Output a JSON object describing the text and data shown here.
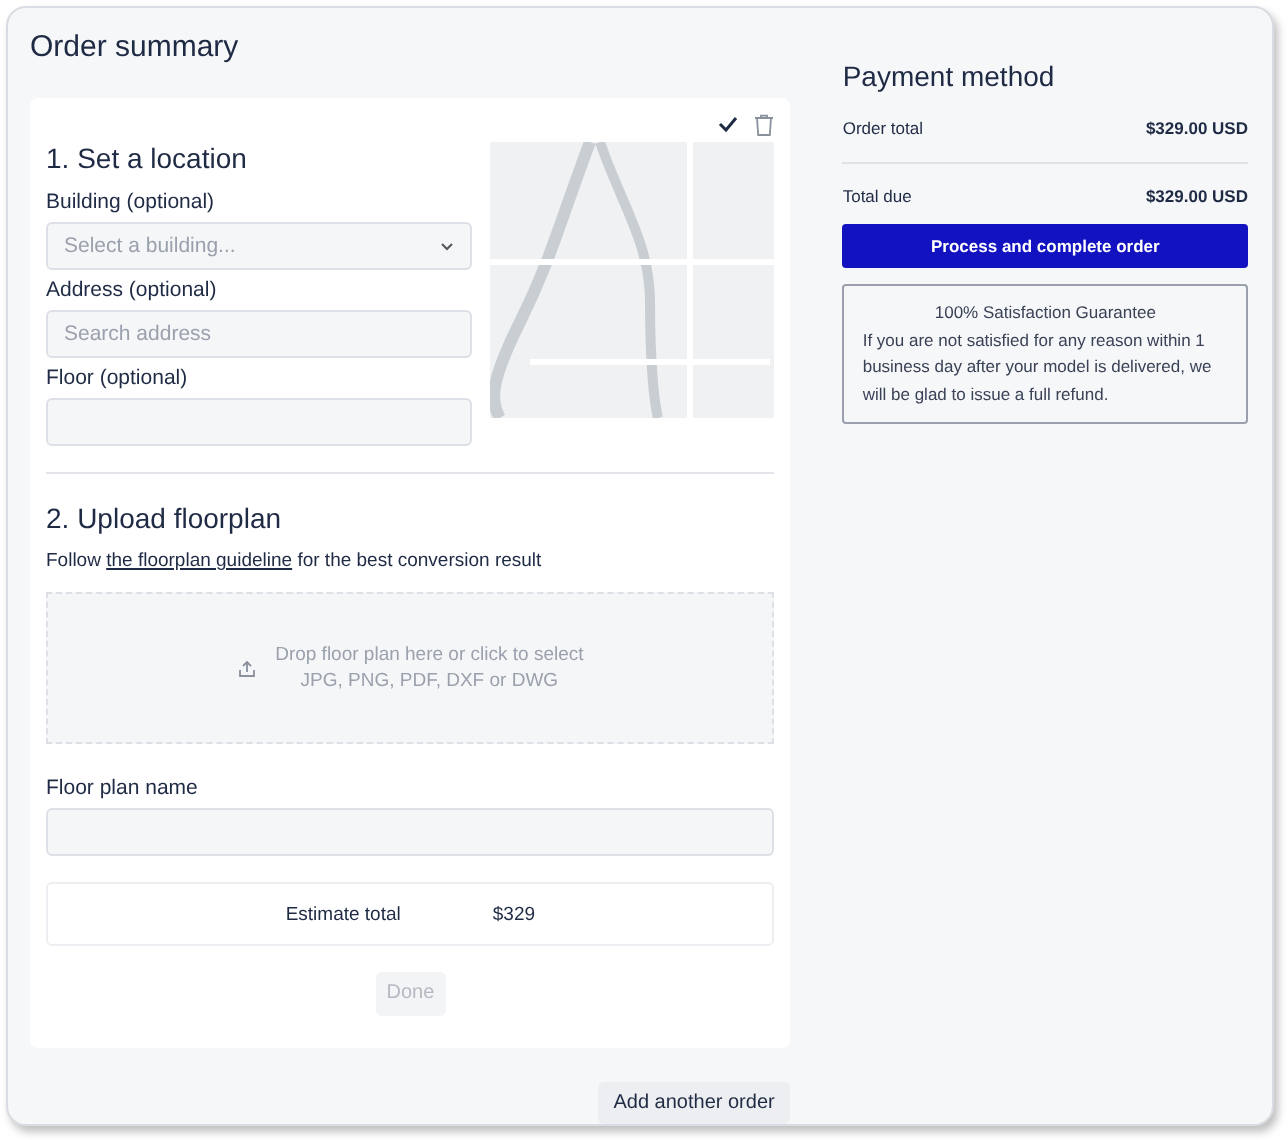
{
  "title": "Order summary",
  "order": {
    "section1": {
      "heading": "1. Set a location",
      "fields": [
        {
          "kind": "select",
          "label": "Building (optional)",
          "placeholder": "Select a building..."
        },
        {
          "kind": "text",
          "label": "Address (optional)",
          "placeholder": "Search address"
        },
        {
          "kind": "text",
          "label": "Floor (optional)"
        }
      ]
    },
    "section2": {
      "heading": "2. Upload floorplan",
      "hint": "Follow ",
      "link": "the floorplan guideline",
      "hint_end": " for the best conversion result",
      "drop_text": "Drop floor plan here or click to select",
      "drop_formats": "JPG, PNG, PDF, DXF or DWG",
      "name_label": "Floor plan name"
    },
    "estimate": {
      "label": "Estimate total",
      "value": "$329"
    },
    "done": {
      "label": "Done",
      "disabled": true
    }
  },
  "add_order": "Add another order",
  "payment": {
    "title": "Payment method",
    "rows": [
      {
        "label": "Order total",
        "value": "$329.00 USD"
      },
      {
        "label": "Total due",
        "value": "$329.00 USD"
      }
    ],
    "button": "Process and complete order",
    "guarantee": {
      "title": "100% Satisfaction Guarantee",
      "text": "If you are not satisfied for any reason within 1 business day after your model is delivered, we will be glad to issue a full refund."
    }
  }
}
